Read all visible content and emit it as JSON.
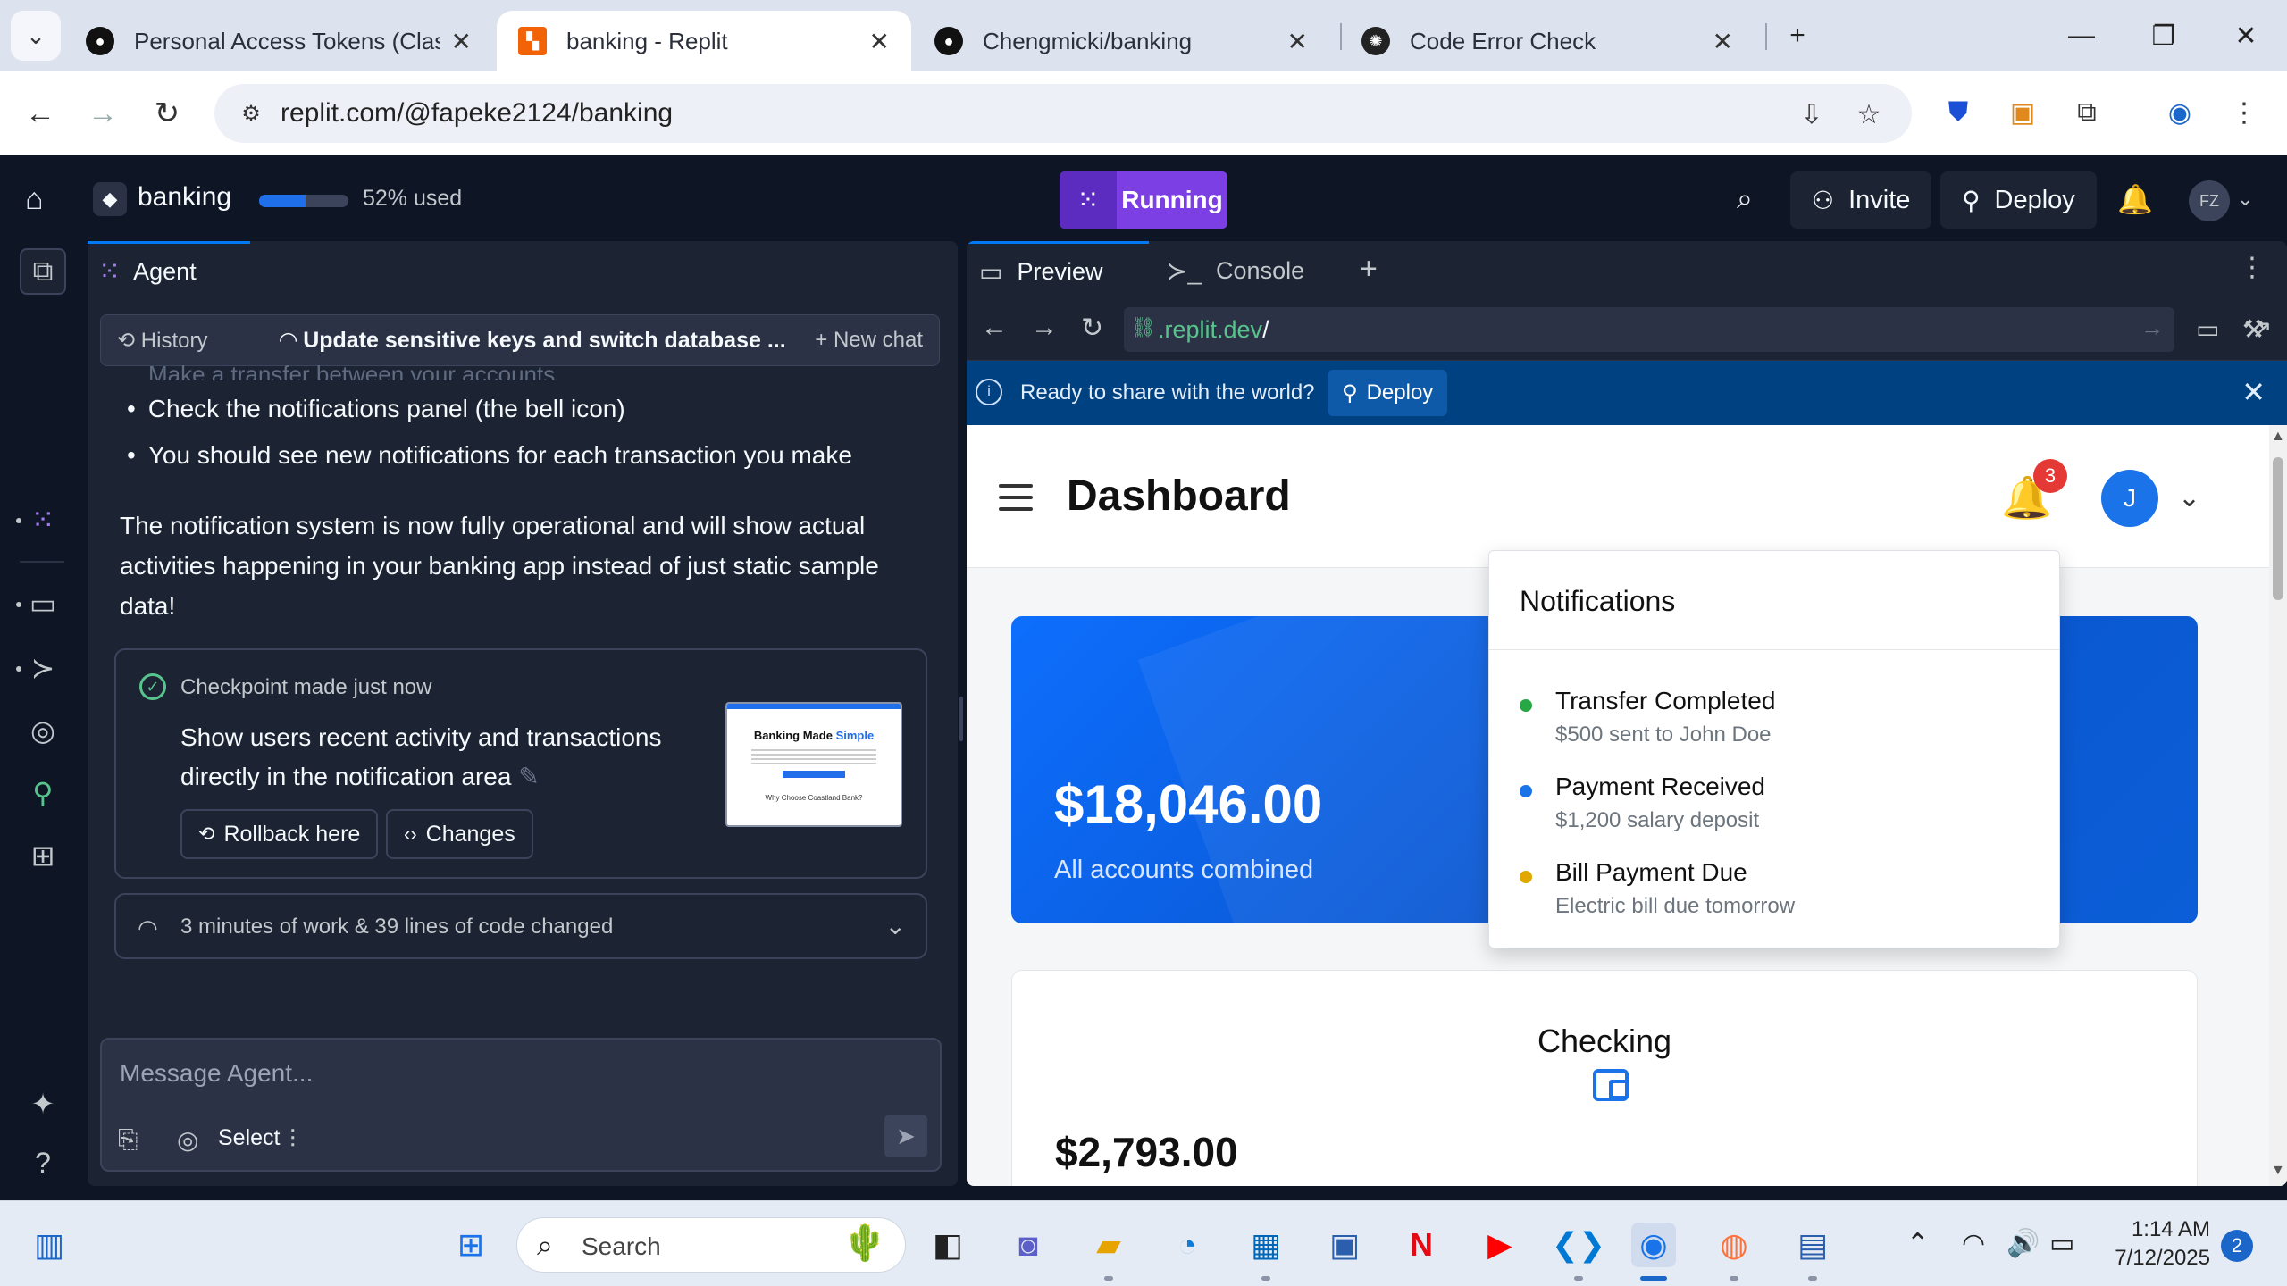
{
  "browser": {
    "tabs": [
      {
        "title": "Personal Access Tokens (Classic)",
        "icon": "github-icon"
      },
      {
        "title": "banking - Replit",
        "icon": "replit-icon",
        "active": true
      },
      {
        "title": "Chengmicki/banking",
        "icon": "github-icon"
      },
      {
        "title": "Code Error Check",
        "icon": "openai-icon"
      }
    ],
    "url": "replit.com/@fapeke2124/banking"
  },
  "replit": {
    "repl_name": "banking",
    "usage_fraction": 0.52,
    "usage_text": "52% used",
    "run_label": "Running",
    "invite_label": "Invite",
    "deploy_label": "Deploy",
    "avatar_initials": "FZ"
  },
  "agent": {
    "tab_label": "Agent",
    "history_label": "History",
    "chat_title": "Update sensitive keys and switch database ...",
    "new_chat_label": "New chat",
    "faded_line": "Make a transfer between your accounts",
    "bullets": [
      "Check the notifications panel (the bell icon)",
      "You should see new notifications for each transaction you make"
    ],
    "message_lines": [
      "The notification system is now fully operational and will show actual",
      "activities happening in your banking app instead of just static sample",
      "data!"
    ],
    "checkpoint": {
      "meta": "Checkpoint made just now",
      "desc_line1": "Show users recent activity and transactions",
      "desc_line2": "directly in the notification area",
      "rollback_label": "Rollback here",
      "changes_label": "Changes",
      "thumb_title_a": "Banking Made ",
      "thumb_title_b": "Simple",
      "thumb_sub": "Why Choose Coastland Bank?"
    },
    "work_summary": "3 minutes of work & 39 lines of code changed",
    "composer_placeholder": "Message Agent...",
    "select_label": "Select"
  },
  "preview": {
    "tab_preview": "Preview",
    "tab_console": "Console",
    "url_host": ".replit.dev",
    "url_path": "/",
    "share_text": "Ready to share with the world?",
    "share_deploy": "Deploy"
  },
  "webapp": {
    "title": "Dashboard",
    "badge_count": "3",
    "user_initial": "J",
    "total_balance": "$18,046.00",
    "total_label": "All accounts combined",
    "account_name": "Checking",
    "account_balance": "$2,793.00",
    "notifications": {
      "title": "Notifications",
      "items": [
        {
          "title": "Transfer Completed",
          "sub": "$500 sent to John Doe",
          "color": "#28a745"
        },
        {
          "title": "Payment Received",
          "sub": "$1,200 salary deposit",
          "color": "#1a73e8"
        },
        {
          "title": "Bill Payment Due",
          "sub": "Electric bill due tomorrow",
          "color": "#e0a800"
        }
      ]
    }
  },
  "taskbar": {
    "search_label": "Search",
    "time": "1:14 AM",
    "date": "7/12/2025",
    "notification_count": "2"
  }
}
